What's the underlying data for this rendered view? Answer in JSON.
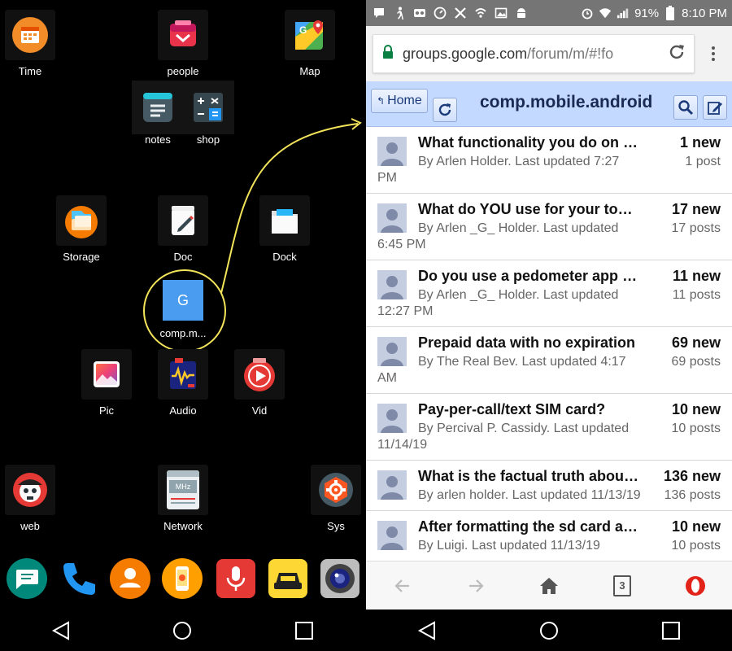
{
  "launcher": {
    "apps": [
      {
        "label": "Time",
        "icon": "calendar-icon"
      },
      {
        "label": "people",
        "icon": "people-icon"
      },
      {
        "label": "Map",
        "icon": "map-icon"
      },
      {
        "label": "notes",
        "icon": "notes-icon"
      },
      {
        "label": "shop",
        "icon": "calculator-icon"
      },
      {
        "label": "Storage",
        "icon": "storage-folder-icon"
      },
      {
        "label": "Doc",
        "icon": "document-icon"
      },
      {
        "label": "Dock",
        "icon": "dock-folder-icon"
      },
      {
        "label": "comp.m...",
        "icon": "google-groups-icon",
        "glyph": "G"
      },
      {
        "label": "Pic",
        "icon": "gallery-icon"
      },
      {
        "label": "Audio",
        "icon": "audio-icon"
      },
      {
        "label": "Vid",
        "icon": "video-icon"
      },
      {
        "label": "web",
        "icon": "web-icon"
      },
      {
        "label": "Network",
        "icon": "radio-icon",
        "glyph": "MHz"
      },
      {
        "label": "Sys",
        "icon": "settings-icon"
      }
    ],
    "dock": [
      "messages-icon",
      "phone-icon",
      "contacts-icon",
      "launcher-icon",
      "voice-icon",
      "taxi-icon",
      "camera-icon"
    ],
    "highlight_color": "#f3e45a"
  },
  "status": {
    "battery": "91%",
    "time": "8:10 PM"
  },
  "browser": {
    "url_host": "groups.google.com",
    "url_path": "/forum/m/#!fo",
    "home_label": "Home",
    "forum_title": "comp.mobile.android",
    "tab_count": "3",
    "topics": [
      {
        "title": "What functionality you do on iOS ...",
        "meta": "By Arlen Holder. Last updated 7:27 PM",
        "new": "1 new",
        "posts": "1 post"
      },
      {
        "title": "What do YOU use for your todo/...",
        "meta": "By Arlen _G_ Holder. Last updated 6:45 PM",
        "new": "17 new",
        "posts": "17 posts"
      },
      {
        "title": "Do you use a pedometer app th...",
        "meta": "By Arlen _G_ Holder. Last updated 12:27 PM",
        "new": "11 new",
        "posts": "11 posts"
      },
      {
        "title": "Prepaid data with no expiration",
        "meta": "By The Real Bev. Last updated 4:17 AM",
        "new": "69 new",
        "posts": "69 posts"
      },
      {
        "title": "Pay-per-call/text SIM card?",
        "meta": "By Percival P. Cassidy. Last updated 11/14/19",
        "new": "10 new",
        "posts": "10 posts"
      },
      {
        "title": "What is the factual truth about ...",
        "meta": "By arlen holder. Last updated 11/13/19",
        "new": "136 new",
        "posts": "136 posts"
      },
      {
        "title": "After formatting the sd card as i...",
        "meta": "By Luigi. Last updated 11/13/19",
        "new": "10 new",
        "posts": "10 posts"
      }
    ]
  }
}
